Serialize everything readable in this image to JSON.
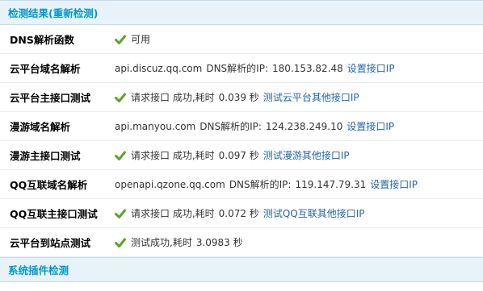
{
  "header": {
    "title": "检测结果(重新检测)"
  },
  "rows": [
    {
      "label": "DNS解析函数",
      "text": "可用"
    },
    {
      "label": "云平台域名解析",
      "host": "api.discuz.qq.com",
      "dns_label": "DNS解析的IP:",
      "ip": "180.153.82.48",
      "link": "设置接口IP"
    },
    {
      "label": "云平台主接口测试",
      "result": "请求接口  成功,耗时",
      "time": "0.039 秒",
      "link": "测试云平台其他接口IP"
    },
    {
      "label": "漫游域名解析",
      "host": "api.manyou.com",
      "dns_label": "DNS解析的IP:",
      "ip": "124.238.249.10",
      "link": "设置接口IP"
    },
    {
      "label": "漫游主接口测试",
      "result": "请求接口  成功,耗时",
      "time": "0.097 秒",
      "link": "测试漫游其他接口IP"
    },
    {
      "label": "QQ互联域名解析",
      "host": "openapi.qzone.qq.com",
      "dns_label": "DNS解析的IP:",
      "ip": "119.147.79.31",
      "link": "设置接口IP"
    },
    {
      "label": "QQ互联主接口测试",
      "result": "请求接口  成功,耗时",
      "time": "0.072 秒",
      "link": "测试QQ互联其他接口IP"
    },
    {
      "label": "云平台到站点测试",
      "result": "测试成功,耗时",
      "time": "3.0983 秒"
    }
  ],
  "footer_header": {
    "title": "系统插件检测"
  },
  "colors": {
    "accent": "#0099cc",
    "link": "#2366a8",
    "check": "#5aa32a",
    "header_bg": "#e8f2f9"
  },
  "icons": {
    "status": "check-icon"
  }
}
